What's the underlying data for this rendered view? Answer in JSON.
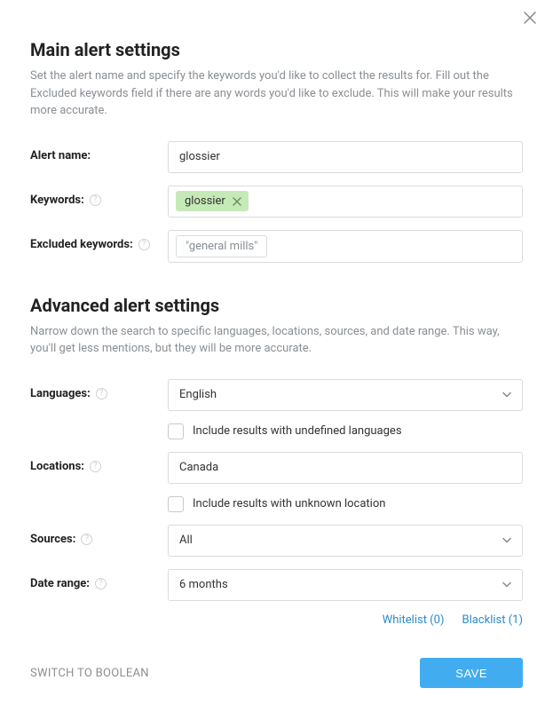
{
  "close_label": "Close",
  "main": {
    "title": "Main alert settings",
    "description": "Set the alert name and specify the keywords you'd like to collect the results for. Fill out the Excluded keywords field if there are any words you'd like to exclude. This will make your results more accurate.",
    "alert_name_label": "Alert name:",
    "alert_name_value": "glossier",
    "keywords_label": "Keywords:",
    "keywords": [
      {
        "text": "glossier"
      }
    ],
    "excluded_label": "Excluded keywords:",
    "excluded_placeholder": "\"general mills\""
  },
  "advanced": {
    "title": "Advanced alert settings",
    "description": "Narrow down the search to specific languages, locations, sources, and date range. This way, you'll get less mentions, but they will be more accurate.",
    "languages_label": "Languages:",
    "languages_value": "English",
    "include_undefined_languages_label": "Include results with undefined languages",
    "locations_label": "Locations:",
    "locations_value": "Canada",
    "include_unknown_location_label": "Include results with unknown location",
    "sources_label": "Sources:",
    "sources_value": "All",
    "date_range_label": "Date range:",
    "date_range_value": "6 months",
    "whitelist_label": "Whitelist (0)",
    "blacklist_label": "Blacklist (1)"
  },
  "footer": {
    "switch_label": "SWITCH TO BOOLEAN",
    "save_label": "SAVE"
  }
}
